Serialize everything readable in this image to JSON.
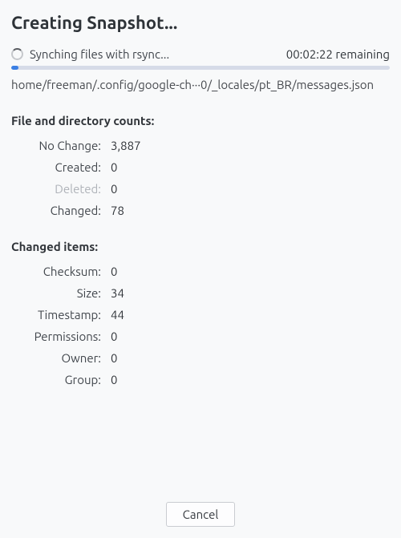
{
  "title": "Creating Snapshot...",
  "status": {
    "text": "Synching files with rsync...",
    "remaining": "00:02:22 remaining",
    "progress_percent": 2
  },
  "current_path": "home/freeman/.config/google-ch···0/_locales/pt_BR/messages.json",
  "file_counts": {
    "header": "File and directory counts:",
    "no_change_label": "No Change:",
    "no_change_value": "3,887",
    "created_label": "Created:",
    "created_value": "0",
    "deleted_label": "Deleted:",
    "deleted_value": "0",
    "changed_label": "Changed:",
    "changed_value": "78"
  },
  "changed_items": {
    "header": "Changed items:",
    "checksum_label": "Checksum:",
    "checksum_value": "0",
    "size_label": "Size:",
    "size_value": "34",
    "timestamp_label": "Timestamp:",
    "timestamp_value": "44",
    "permissions_label": "Permissions:",
    "permissions_value": "0",
    "owner_label": "Owner:",
    "owner_value": "0",
    "group_label": "Group:",
    "group_value": "0"
  },
  "footer": {
    "cancel_label": "Cancel"
  }
}
